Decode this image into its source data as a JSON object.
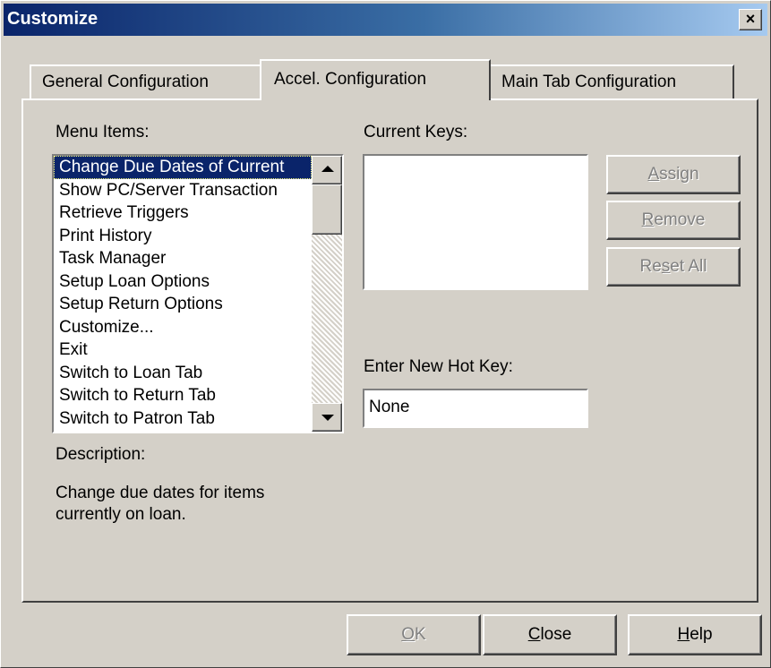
{
  "window": {
    "title": "Customize",
    "close_glyph": "×"
  },
  "tabs": [
    {
      "label": "General Configuration",
      "active": false
    },
    {
      "label": "Accel. Configuration",
      "active": true
    },
    {
      "label": "Main Tab Configuration",
      "active": false
    }
  ],
  "menu_items": {
    "label": "Menu Items:",
    "items": [
      "Change Due Dates of Current",
      "Show PC/Server Transaction",
      "Retrieve Triggers",
      "Print History",
      "Task Manager",
      "Setup Loan Options",
      "Setup Return Options",
      "Customize...",
      "Exit",
      "Switch to Loan Tab",
      "Switch to Return Tab",
      "Switch to Patron Tab"
    ],
    "selected_index": 0
  },
  "current_keys": {
    "label": "Current Keys:"
  },
  "side_buttons": {
    "assign": {
      "pre": "",
      "mnemonic": "A",
      "post": "ssign",
      "enabled": false
    },
    "remove": {
      "pre": "",
      "mnemonic": "R",
      "post": "emove",
      "enabled": false
    },
    "reset_all": {
      "pre": "Re",
      "mnemonic": "s",
      "post": "et All",
      "enabled": false
    }
  },
  "hotkey": {
    "label": "Enter New Hot Key:",
    "value": "None"
  },
  "description": {
    "label": "Description:",
    "line1": "Change due dates for items",
    "line2": "currently on loan."
  },
  "bottom_buttons": {
    "ok": {
      "pre": "",
      "mnemonic": "O",
      "post": "K",
      "enabled": false
    },
    "close": {
      "pre": "",
      "mnemonic": "C",
      "post": "lose",
      "enabled": true
    },
    "help": {
      "pre": "",
      "mnemonic": "H",
      "post": "elp",
      "enabled": true
    }
  },
  "colors": {
    "title_gradient_start": "#0a246a",
    "title_gradient_end": "#a6caf0",
    "face": "#d4d0c8",
    "selection": "#0a246a",
    "disabled_text": "#808080"
  }
}
